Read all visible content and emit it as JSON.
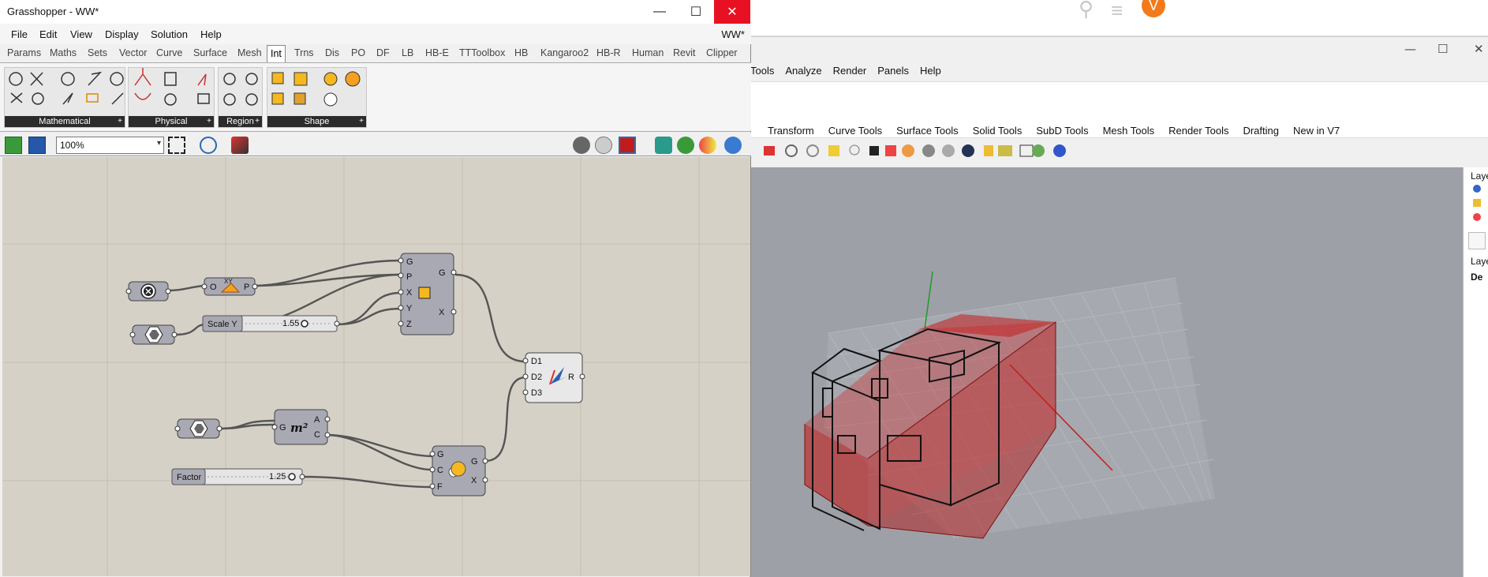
{
  "gh": {
    "title": "Grasshopper - WW*",
    "doc_name": "WW*",
    "window_controls": {
      "minimize": "—",
      "maximize": "☐",
      "close": "✕"
    },
    "menu": [
      "File",
      "Edit",
      "View",
      "Display",
      "Solution",
      "Help"
    ],
    "tabs": [
      "Params",
      "Maths",
      "Sets",
      "Vector",
      "Curve",
      "Surface",
      "Mesh",
      "Int",
      "Trns",
      "Dis",
      "PO",
      "DF",
      "LB",
      "HB-E",
      "TTToolbox",
      "HB",
      "Kangaroo2",
      "HB-R",
      "Human",
      "Revit",
      "Clipper"
    ],
    "active_tab": "Int",
    "ribbon_groups": [
      "Mathematical",
      "Physical",
      "Region",
      "Shape"
    ],
    "zoom": "100%",
    "canvas": {
      "scale_component": {
        "inputs": [
          "G",
          "P",
          "X",
          "Y",
          "Z"
        ],
        "outputs": [
          "G",
          "X"
        ]
      },
      "xy_plane": {
        "input": "O",
        "output": "P",
        "label": "XY"
      },
      "slider_scale_y": {
        "name": "Scale Y",
        "value": "1.55"
      },
      "area": {
        "input": "G",
        "outputs": [
          "A",
          "C"
        ],
        "label": "m²"
      },
      "scale_uniform": {
        "inputs": [
          "G",
          "C",
          "F"
        ],
        "outputs": [
          "G",
          "X"
        ]
      },
      "slider_factor": {
        "name": "Factor",
        "value": "1.25"
      },
      "merge": {
        "inputs": [
          "D1",
          "D2",
          "D3"
        ],
        "output": "R"
      }
    }
  },
  "rhino": {
    "menu": [
      "Tools",
      "Analyze",
      "Render",
      "Panels",
      "Help"
    ],
    "tabs": [
      "Transform",
      "Curve Tools",
      "Surface Tools",
      "Solid Tools",
      "SubD Tools",
      "Mesh Tools",
      "Render Tools",
      "Drafting",
      "New in V7"
    ],
    "window_controls": {
      "minimize": "—",
      "maximize": "☐",
      "close": "✕"
    },
    "layers_panel": {
      "header": "Laye",
      "header2": "Laye",
      "item": "De"
    },
    "browser_avatar": "V"
  },
  "colors": {
    "accent_orange": "#f27a1a",
    "close_red": "#e81123",
    "canvas": "#d6d1c6",
    "component": "#a9a9b3",
    "selection_red": "#c01818"
  }
}
